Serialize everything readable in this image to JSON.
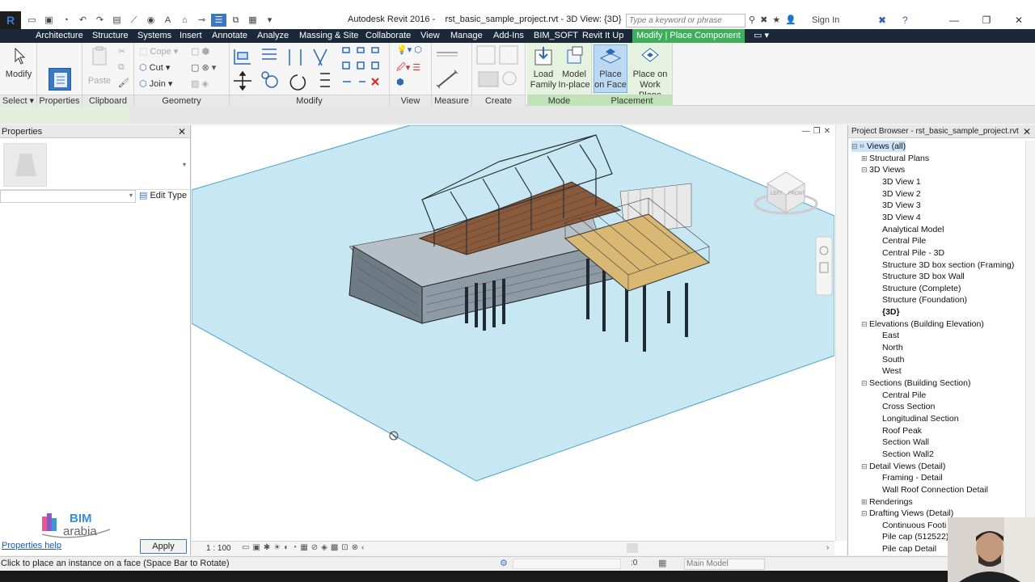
{
  "app": {
    "title": "Autodesk Revit 2016 -    rst_basic_sample_project.rvt - 3D View: {3D}",
    "search_placeholder": "Type a keyword or phrase",
    "sign_in": "Sign In",
    "logo_letter": "R"
  },
  "tabs": [
    "Architecture",
    "Structure",
    "Systems",
    "Insert",
    "Annotate",
    "Analyze",
    "Massing & Site",
    "Collaborate",
    "View",
    "Manage",
    "Add-Ins",
    "BIM_SOFT",
    "Revit It Up",
    "Modify | Place Component"
  ],
  "ribbon": {
    "select": {
      "modify_label": "Modify",
      "panel_label": "Select"
    },
    "properties": {
      "panel_label": "Properties"
    },
    "clipboard": {
      "paste_label": "Paste",
      "panel_label": "Clipboard"
    },
    "geometry": {
      "cope_label": "Cope",
      "cut_label": "Cut",
      "join_label": "Join",
      "panel_label": "Geometry"
    },
    "modify": {
      "panel_label": "Modify"
    },
    "view": {
      "panel_label": "View"
    },
    "measure": {
      "panel_label": "Measure"
    },
    "create": {
      "panel_label": "Create"
    },
    "mode": {
      "load_family": "Load Family",
      "model_inplace": "Model In-place",
      "panel_label": "Mode"
    },
    "placement": {
      "place_on_face": "Place on Face",
      "place_on_work_plane": "Place on Work Plane",
      "panel_label": "Placement"
    }
  },
  "properties": {
    "title": "Properties",
    "edit_type": "Edit Type",
    "help": "Properties help",
    "apply": "Apply",
    "logo_text_1": "BIM",
    "logo_text_2": "arabia"
  },
  "viewport": {
    "scale": "1 : 100",
    "viewcube_left": "LEFT",
    "viewcube_front": "FRONT"
  },
  "browser": {
    "title": "Project Browser - rst_basic_sample_project.rvt",
    "nodes": [
      {
        "label": "Views (all)",
        "level": 0,
        "toggle": "⊟",
        "selected": true
      },
      {
        "label": "Structural Plans",
        "level": 1,
        "toggle": "⊞"
      },
      {
        "label": "3D Views",
        "level": 1,
        "toggle": "⊟"
      },
      {
        "label": "3D View 1",
        "level": 2
      },
      {
        "label": "3D View 2",
        "level": 2
      },
      {
        "label": "3D View 3",
        "level": 2
      },
      {
        "label": "3D View 4",
        "level": 2
      },
      {
        "label": "Analytical Model",
        "level": 2
      },
      {
        "label": "Central Pile",
        "level": 2
      },
      {
        "label": "Central Pile - 3D",
        "level": 2
      },
      {
        "label": "Structure 3D box section (Framing)",
        "level": 2
      },
      {
        "label": "Structure 3D box Wall",
        "level": 2
      },
      {
        "label": "Structure (Complete)",
        "level": 2
      },
      {
        "label": "Structure (Foundation)",
        "level": 2
      },
      {
        "label": "{3D}",
        "level": 2,
        "bold": true
      },
      {
        "label": "Elevations (Building Elevation)",
        "level": 1,
        "toggle": "⊟"
      },
      {
        "label": "East",
        "level": 2
      },
      {
        "label": "North",
        "level": 2
      },
      {
        "label": "South",
        "level": 2
      },
      {
        "label": "West",
        "level": 2
      },
      {
        "label": "Sections (Building Section)",
        "level": 1,
        "toggle": "⊟"
      },
      {
        "label": "Central Pile",
        "level": 2
      },
      {
        "label": "Cross Section",
        "level": 2
      },
      {
        "label": "Longitudinal Section",
        "level": 2
      },
      {
        "label": "Roof Peak",
        "level": 2
      },
      {
        "label": "Section Wall",
        "level": 2
      },
      {
        "label": "Section Wall2",
        "level": 2
      },
      {
        "label": "Detail Views (Detail)",
        "level": 1,
        "toggle": "⊟"
      },
      {
        "label": "Framing - Detail",
        "level": 2
      },
      {
        "label": "Wall Roof Connection Detail",
        "level": 2
      },
      {
        "label": "Renderings",
        "level": 1,
        "toggle": "⊞"
      },
      {
        "label": "Drafting Views (Detail)",
        "level": 1,
        "toggle": "⊟"
      },
      {
        "label": "Continuous Footi",
        "level": 2
      },
      {
        "label": "Pile cap (512522)",
        "level": 2
      },
      {
        "label": "Pile cap Detail",
        "level": 2
      }
    ]
  },
  "status": {
    "message": "Click to place an instance on a face (Space Bar to Rotate)",
    "zero": ":0",
    "workset": "Main Model"
  },
  "colors": {
    "tab_bar": "#1b2838",
    "context_tab": "#3fae5b",
    "plane": "#c7e8f3",
    "floor": "#d9b873"
  }
}
